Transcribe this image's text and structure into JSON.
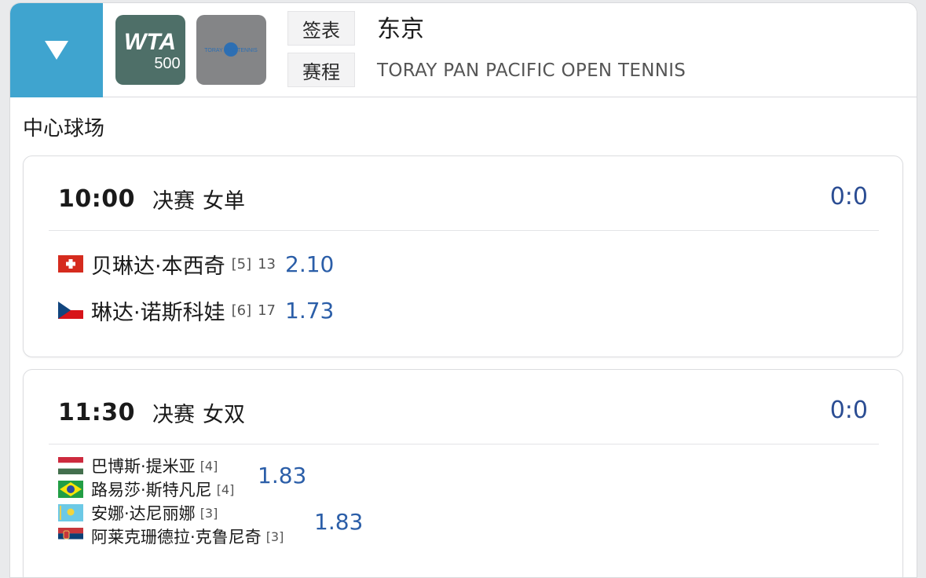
{
  "header": {
    "toggle_icon": "triangle-down-icon",
    "wta_logo": {
      "line1": "WTA",
      "line2": "500"
    },
    "toray_logo": {
      "text": "TORAY PPO TENNIS"
    },
    "tabs": [
      {
        "label": "签表"
      },
      {
        "label": "赛程"
      }
    ],
    "city": "东京",
    "tournament": "TORAY PAN PACIFIC OPEN TENNIS"
  },
  "court": "中心球场",
  "matches": [
    {
      "time": "10:00",
      "round": "决赛",
      "type": "女单",
      "score": "0:0",
      "players": [
        {
          "name": "贝琳达·本西奇",
          "seed": "[5]",
          "rank": "13",
          "odds": "2.10",
          "flag": "switzerland"
        },
        {
          "name": "琳达·诺斯科娃",
          "seed": "[6]",
          "rank": "17",
          "odds": "1.73",
          "flag": "czech"
        }
      ]
    },
    {
      "time": "11:30",
      "round": "决赛",
      "type": "女双",
      "score": "0:0",
      "players": [
        {
          "name": "巴博斯·提米亚",
          "seed": "[4]",
          "flag": "hungary"
        },
        {
          "name": "路易莎·斯特凡尼",
          "seed": "[4]",
          "flag": "brazil"
        },
        {
          "name": "安娜·达尼丽娜",
          "seed": "[3]",
          "flag": "kazakhstan"
        },
        {
          "name": "阿莱克珊德拉·克鲁尼奇",
          "seed": "[3]",
          "flag": "serbia"
        }
      ],
      "team_odds": [
        "1.83",
        "1.83"
      ]
    }
  ],
  "colors": {
    "accent": "#3fa4cf",
    "score": "#2b4d93",
    "odds": "#2b5ea8"
  }
}
